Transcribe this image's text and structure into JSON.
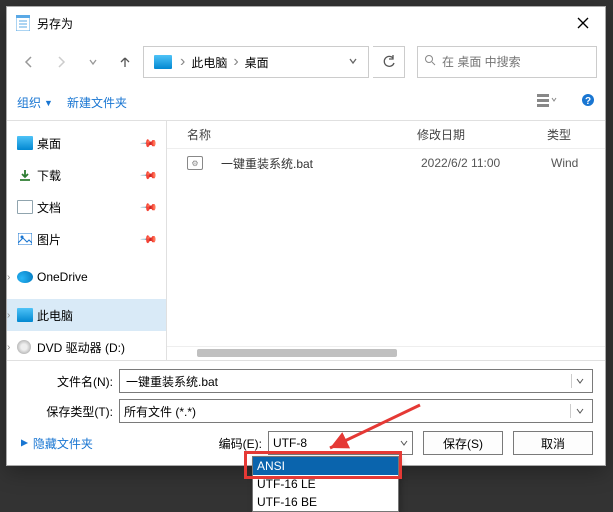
{
  "title": "另存为",
  "breadcrumb": {
    "root": "此电脑",
    "folder": "桌面"
  },
  "search": {
    "placeholder": "在 桌面 中搜索"
  },
  "toolbar": {
    "organize": "组织",
    "newfolder": "新建文件夹"
  },
  "columns": {
    "name": "名称",
    "date": "修改日期",
    "type": "类型"
  },
  "sidebar": {
    "desktop": "桌面",
    "downloads": "下载",
    "documents": "文档",
    "pictures": "图片",
    "onedrive": "OneDrive",
    "thispc": "此电脑",
    "dvd": "DVD 驱动器 (D:)"
  },
  "files": [
    {
      "name": "一键重装系统.bat",
      "date": "2022/6/2 11:00",
      "type": "Wind"
    }
  ],
  "form": {
    "filename_label": "文件名(N):",
    "filename_value": "一键重装系统.bat",
    "filetype_label": "保存类型(T):",
    "filetype_value": "所有文件 (*.*)",
    "hide_folders": "隐藏文件夹",
    "encoding_label": "编码(E):",
    "encoding_value": "UTF-8",
    "save": "保存(S)",
    "cancel": "取消"
  },
  "encoding_options": {
    "o0": "ANSI",
    "o1": "UTF-16 LE",
    "o2": "UTF-16 BE"
  }
}
